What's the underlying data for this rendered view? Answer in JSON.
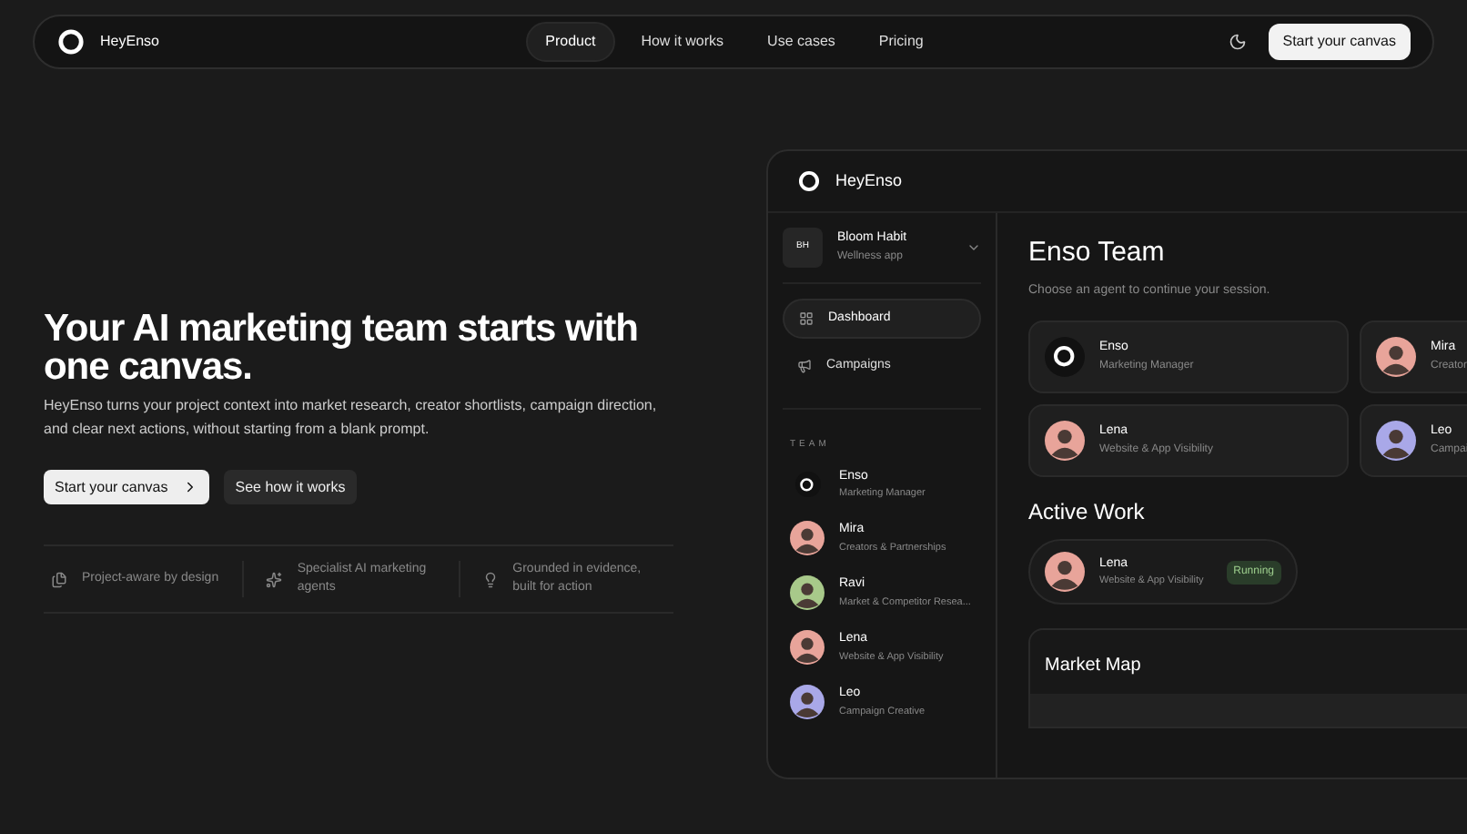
{
  "nav": {
    "brand": "HeyEnso",
    "links": [
      {
        "label": "Product",
        "selected": true
      },
      {
        "label": "How it works",
        "selected": false
      },
      {
        "label": "Use cases",
        "selected": false
      },
      {
        "label": "Pricing",
        "selected": false
      }
    ],
    "cta": "Start your canvas"
  },
  "hero": {
    "title": "Your AI marketing team starts with one canvas.",
    "text": "HeyEnso turns your project context into market research, creator shortlists, campaign direction, and clear next actions, without starting from a blank prompt.",
    "primary": "Start your canvas",
    "secondary": "See how it works",
    "features": [
      {
        "kind": "file",
        "label": "Project-aware by design"
      },
      {
        "kind": "sparkle",
        "label": "Specialist AI marketing agents"
      },
      {
        "kind": "bulb",
        "label": "Grounded in evidence, built for action"
      }
    ]
  },
  "app": {
    "brand": "HeyEnso",
    "project": {
      "initials": "BH",
      "name": "Bloom Habit",
      "subtitle": "Wellness app"
    },
    "menu": [
      {
        "kind": "grid",
        "label": "Dashboard",
        "selected": true
      },
      {
        "kind": "megaphone",
        "label": "Campaigns",
        "selected": false
      }
    ],
    "team_heading": "TEAM",
    "team": [
      {
        "kind": "logo",
        "name": "Enso",
        "role": "Marketing Manager"
      },
      {
        "kind": "avatar",
        "color": "#e8a49a",
        "name": "Mira",
        "role": "Creators & Partnerships"
      },
      {
        "kind": "avatar",
        "color": "#a8c98a",
        "name": "Ravi",
        "role": "Market & Competitor Resea..."
      },
      {
        "kind": "avatar",
        "color": "#e8a49a",
        "name": "Lena",
        "role": "Website & App Visibility"
      },
      {
        "kind": "avatar",
        "color": "#a9a8e8",
        "name": "Leo",
        "role": "Campaign Creative"
      }
    ],
    "title": "Enso Team",
    "subtitle": "Choose an agent to continue your session.",
    "agents": [
      {
        "kind": "logo",
        "name": "Enso",
        "role": "Marketing Manager"
      },
      {
        "kind": "avatar",
        "color": "#e8a49a",
        "name": "Mira",
        "role": "Creator"
      },
      {
        "kind": "avatar",
        "color": "#e8a49a",
        "name": "Lena",
        "role": "Website & App Visibility"
      },
      {
        "kind": "avatar",
        "color": "#a9a8e8",
        "name": "Leo",
        "role": "Campai"
      }
    ],
    "active_heading": "Active Work",
    "active": {
      "color": "#e8a49a",
      "name": "Lena",
      "role": "Website & App Visibility",
      "status": "Running"
    },
    "map_title": "Market Map"
  }
}
